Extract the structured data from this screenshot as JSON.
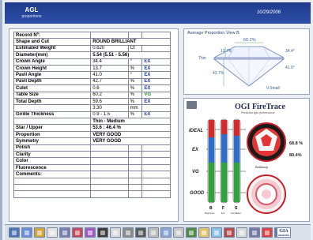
{
  "header": {
    "app_name": "AGL",
    "subtitle": "proportions",
    "date": "10/29/2006"
  },
  "record": {
    "rows": [
      {
        "label": "Record  Nº:",
        "value": "",
        "unit": "",
        "grade": ""
      },
      {
        "label": "Shape and Cut",
        "value": "ROUND BRILLIANT",
        "unit": "",
        "grade": "",
        "wide": true
      },
      {
        "label": "Estimated Weight",
        "value": "0.620",
        "unit": "Ct",
        "grade": ""
      },
      {
        "label": "Diameter(mm)",
        "value": "5.54 (5.51 - 5.56)",
        "unit": "",
        "grade": "",
        "wide": true
      },
      {
        "label": "Crown Angle",
        "value": "34.4",
        "unit": "°",
        "grade": "EX"
      },
      {
        "label": "Crown Height",
        "value": "13.7",
        "unit": "%",
        "grade": "EX"
      },
      {
        "label": "Pavil Angle",
        "value": "41.0",
        "unit": "°",
        "grade": "EX"
      },
      {
        "label": "Pavil Depth",
        "value": "42.7",
        "unit": "%",
        "grade": "EX"
      },
      {
        "label": "Culet",
        "value": "0.6",
        "unit": "%",
        "grade": "EX"
      },
      {
        "label": "Table Size",
        "value": "60.2",
        "unit": "%",
        "grade": "VG"
      },
      {
        "label": "Total Depth",
        "value": "59.6",
        "unit": "%",
        "grade": "EX"
      },
      {
        "label": "",
        "value": "3.30",
        "unit": "mm",
        "grade": ""
      },
      {
        "label": "Girdle Thickness",
        "value": "0.9 - 1.5",
        "unit": "%",
        "grade": "EX"
      },
      {
        "label": "",
        "value": "Thin - Medium",
        "unit": "",
        "grade": "",
        "wide": true
      },
      {
        "label": "Star / Upper",
        "value": "53.6 : 46.4 %",
        "unit": "",
        "grade": "",
        "wide": true
      },
      {
        "label": "Proportion",
        "value": "VERY GOOD",
        "unit": "",
        "grade": "",
        "wide": true
      },
      {
        "label": "Symmetry",
        "value": "VERY GOOD",
        "unit": "",
        "grade": "",
        "wide": true
      },
      {
        "label": "Polish",
        "value": "",
        "unit": "",
        "grade": ""
      },
      {
        "label": "Clarity",
        "value": "",
        "unit": "",
        "grade": ""
      },
      {
        "label": "Color",
        "value": "",
        "unit": "",
        "grade": ""
      },
      {
        "label": "Fluorescence",
        "value": "",
        "unit": "",
        "grade": ""
      },
      {
        "label": "Comments:",
        "value": "",
        "unit": "",
        "grade": ""
      },
      {
        "label": "",
        "value": "",
        "unit": "",
        "grade": ""
      },
      {
        "label": "",
        "value": "",
        "unit": "",
        "grade": ""
      },
      {
        "label": "",
        "value": "",
        "unit": "",
        "grade": ""
      }
    ]
  },
  "proportion_view": {
    "title": "Average Proportion   View B",
    "table_pct": "60.2%",
    "crown_height": "13.7%",
    "crown_angle": "34.4°",
    "pavilion_angle": "41.0°",
    "pavilion_depth": "42.7%",
    "girdle": "Thin",
    "culet": "V.Small"
  },
  "firetrace": {
    "brand": "OGI FireTrace",
    "tagline": "Predicted light performance",
    "grades": [
      "IDEAL",
      "EX",
      "VG",
      "GOOD"
    ],
    "bar_labels": [
      "B",
      "F",
      "S"
    ],
    "bar_captions": [
      "Brightness",
      "Fire",
      "Scintillation"
    ],
    "brightness_label": "Brilliancy",
    "brightness_value": "68.8 %",
    "fire_value": "80.4%"
  },
  "toolbar": {
    "tools": [
      "scan-tool",
      "measure-tool",
      "light-tool",
      "fingerprint-tool",
      "diamond-tool",
      "hearts-tool",
      "prism-tool",
      "paint-tool",
      "document-tool",
      "print-tool",
      "settings-tool",
      "camera-tool",
      "export-tool",
      "note-tool",
      "save-tool",
      "open-tool",
      "view-tool",
      "chart-tool",
      "ruler-tool",
      "diamond-view-tool",
      "cert-tool",
      "calc-tool"
    ],
    "gia_label": "GIA",
    "gia_sub": "GRADING"
  },
  "colors": {
    "header": "#1f3a8c",
    "grade_blue": "#1d3aa8",
    "grade_green": "#1f8a2b",
    "fire_red": "#c81f26"
  }
}
